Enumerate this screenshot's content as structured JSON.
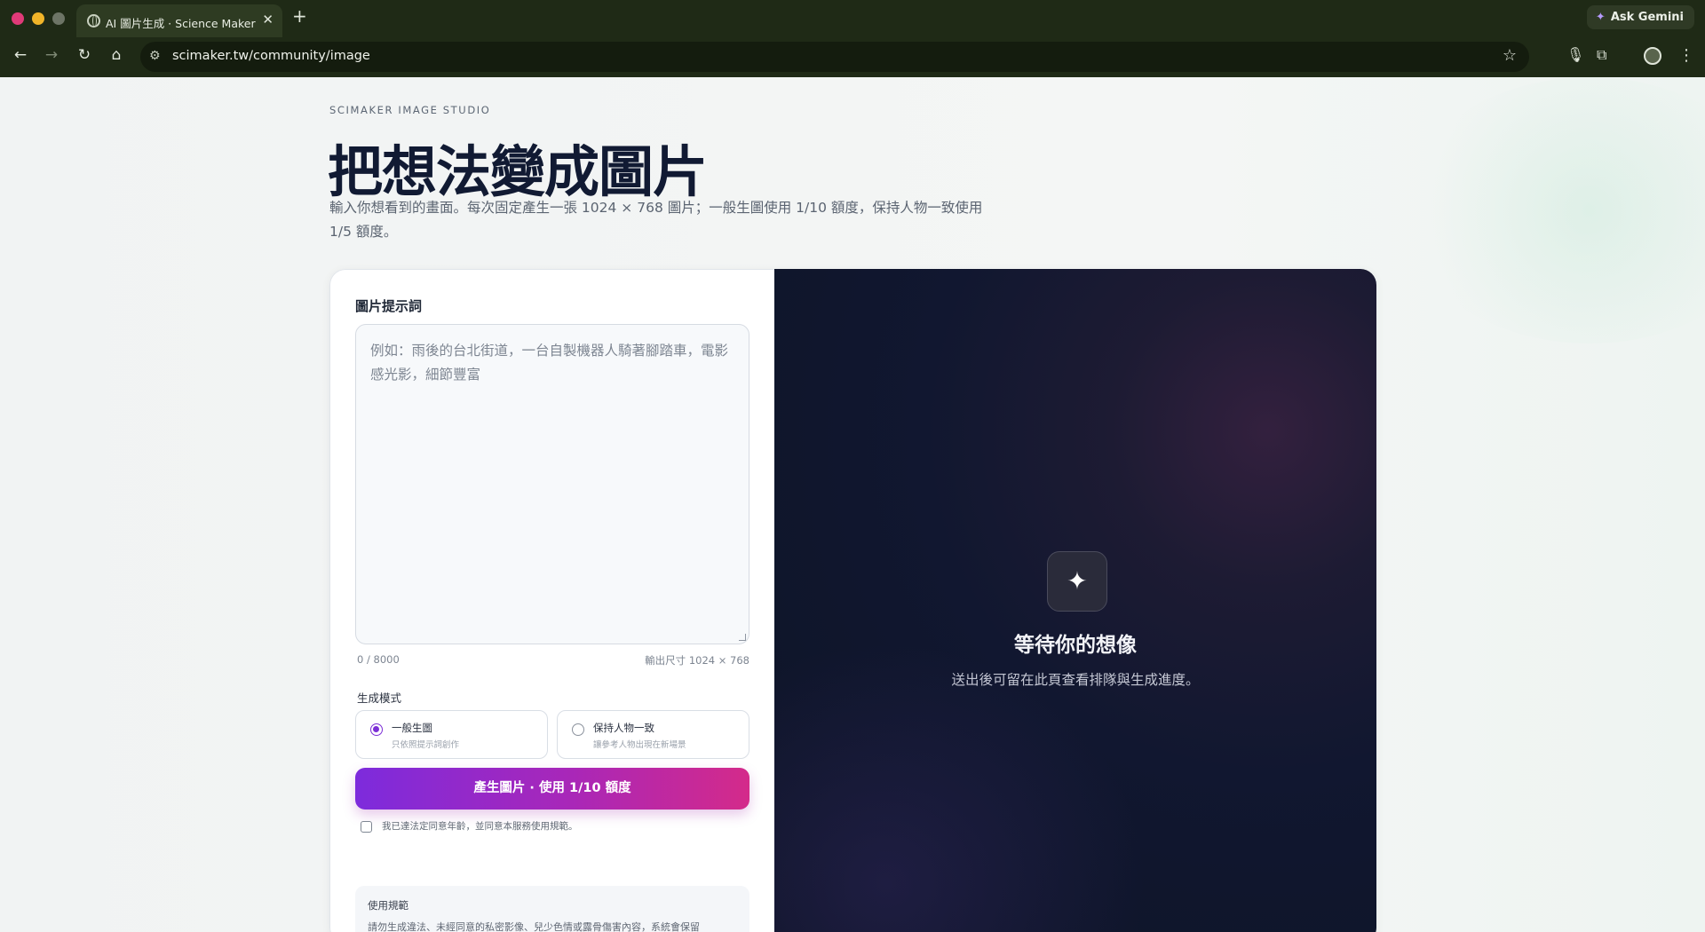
{
  "browser": {
    "tab_title": "AI 圖片生成 · Science Maker",
    "tab_close": "✕",
    "new_tab": "+",
    "ask_gemini": "Ask Gemini",
    "url": "scimaker.tw/community/image"
  },
  "icons": {
    "back": "←",
    "forward": "→",
    "reload": "↻",
    "home": "⌂",
    "site_info": "⚙",
    "bookmark": "☆",
    "mic": "🎙",
    "puzzle": "⧉",
    "menu": "⋮",
    "gemini_star": "✦",
    "sparkle": "✦"
  },
  "header": {
    "eyebrow": "SCIMAKER IMAGE STUDIO",
    "title": "把想法變成圖片",
    "description": "輸入你想看到的畫面。每次固定產生一張 1024 × 768 圖片；一般生圖使用 1/10 額度，保持人物一致使用 1/5 額度。"
  },
  "form": {
    "prompt_label": "圖片提示詞",
    "prompt_placeholder": "例如：雨後的台北街道，一台自製機器人騎著腳踏車，電影感光影，細節豐富",
    "prompt_value": "",
    "counter": "0 / 8000",
    "size_hint": "輸出尺寸 1024 × 768",
    "mode_label": "生成模式",
    "modes": [
      {
        "title": "一般生圖",
        "subtitle": "只依照提示詞創作",
        "selected": true
      },
      {
        "title": "保持人物一致",
        "subtitle": "讓參考人物出現在新場景",
        "selected": false
      }
    ],
    "submit_label": "產生圖片 · 使用 1/10 額度",
    "agree_text": "我已達法定同意年齡，並同意本服務使用規範。",
    "agree_checked": false,
    "rules_title": "使用規範",
    "rules_text": "請勿生成違法、未經同意的私密影像、兒少色情或露骨傷害內容，系統會保留"
  },
  "preview": {
    "title": "等待你的想像",
    "subtitle": "送出後可留在此頁查看排隊與生成進度。"
  },
  "colors": {
    "accent_start": "#7d2bdc",
    "accent_end": "#d42a8a",
    "title": "#111a33",
    "preview_bg": "#0d1426"
  }
}
